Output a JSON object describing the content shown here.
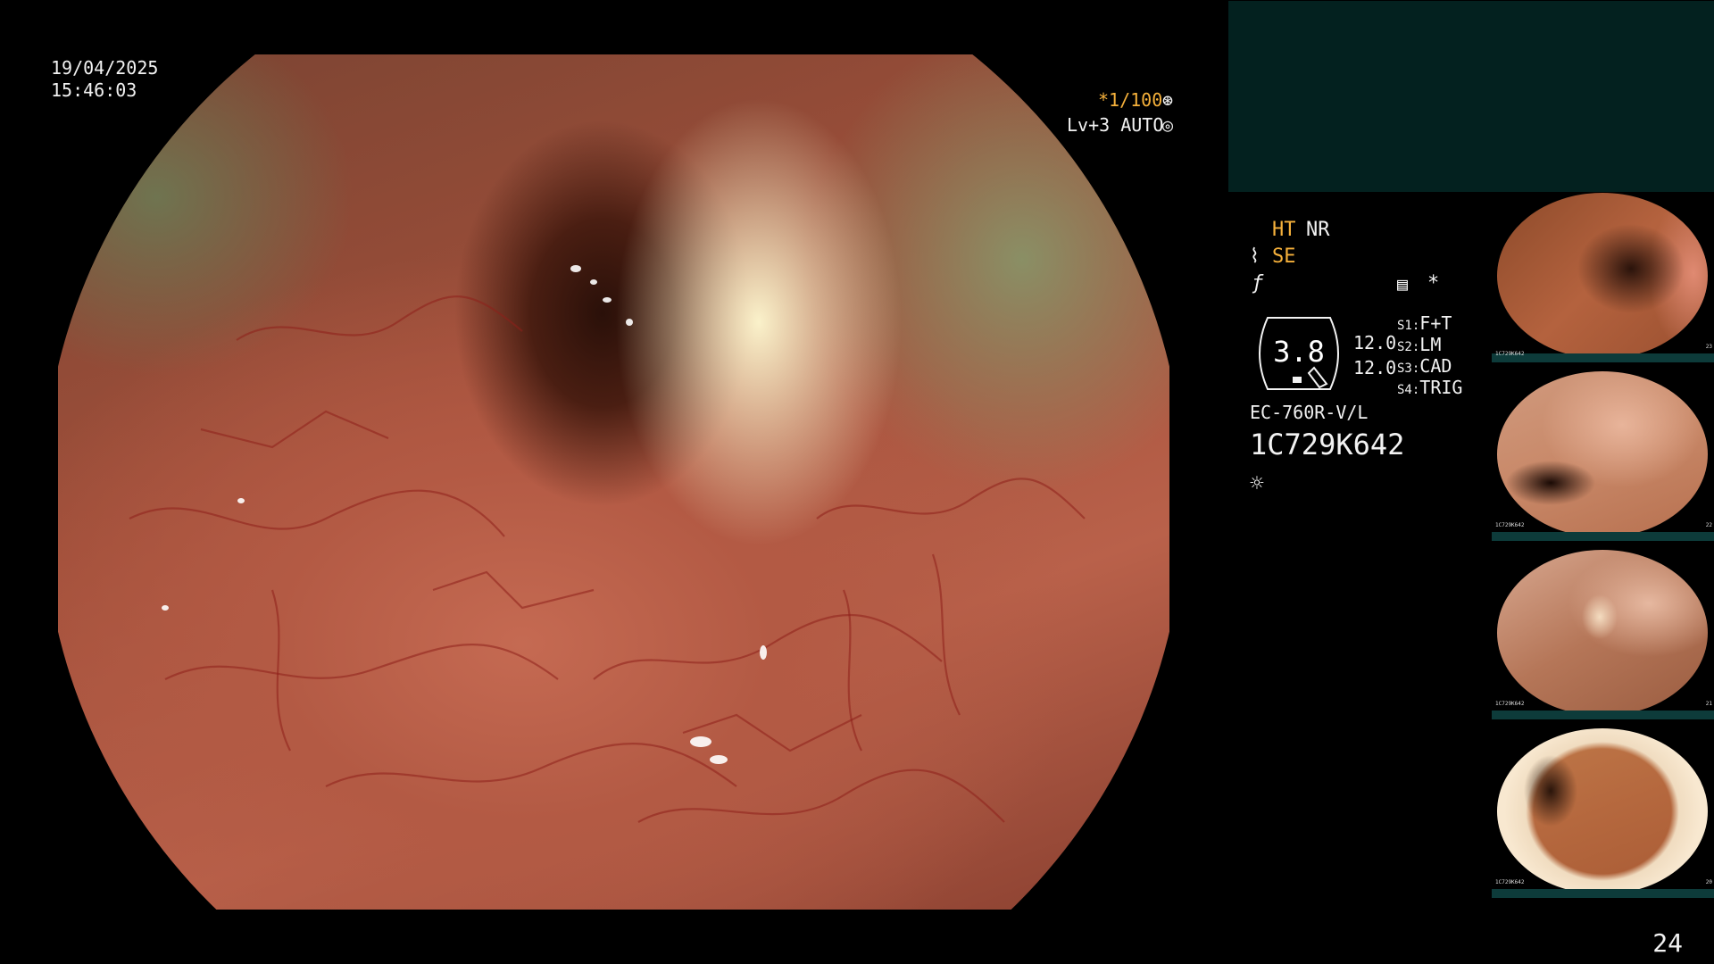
{
  "overlay": {
    "date": "19/04/2025",
    "time": "15:46:03",
    "shutter": "*1/100",
    "shutter_icon": "aperture-icon",
    "level": "Lv+3 AUTO",
    "level_icon": "iris-icon"
  },
  "settings": {
    "ht": "HT",
    "nr": "NR",
    "se": "SE",
    "se_icon": "tilde-icon",
    "f_icon": "f-symbol-icon",
    "menu_icon": "list-icon",
    "star": "*",
    "lens_value": "3.8",
    "s_values": [
      "12.0",
      "12.0"
    ],
    "switches": [
      {
        "key": "S1:",
        "value": "F+T"
      },
      {
        "key": "S2:",
        "value": "LM"
      },
      {
        "key": "S3:",
        "value": "CAD"
      },
      {
        "key": "S4:",
        "value": "TRIG"
      }
    ],
    "model": "EC-760R-V/L",
    "serial": "1C729K642",
    "light_icon": "sun-icon"
  },
  "thumbnails": [
    {
      "id_text": "1C729K642",
      "index": "23"
    },
    {
      "id_text": "1C729K642",
      "index": "22"
    },
    {
      "id_text": "1C729K642",
      "index": "21"
    },
    {
      "id_text": "1C729K642",
      "index": "20"
    }
  ],
  "page_number": "24",
  "colors": {
    "accent_orange": "#f6b13b",
    "panel_teal": "#03211f",
    "text": "#f2f2f2"
  }
}
